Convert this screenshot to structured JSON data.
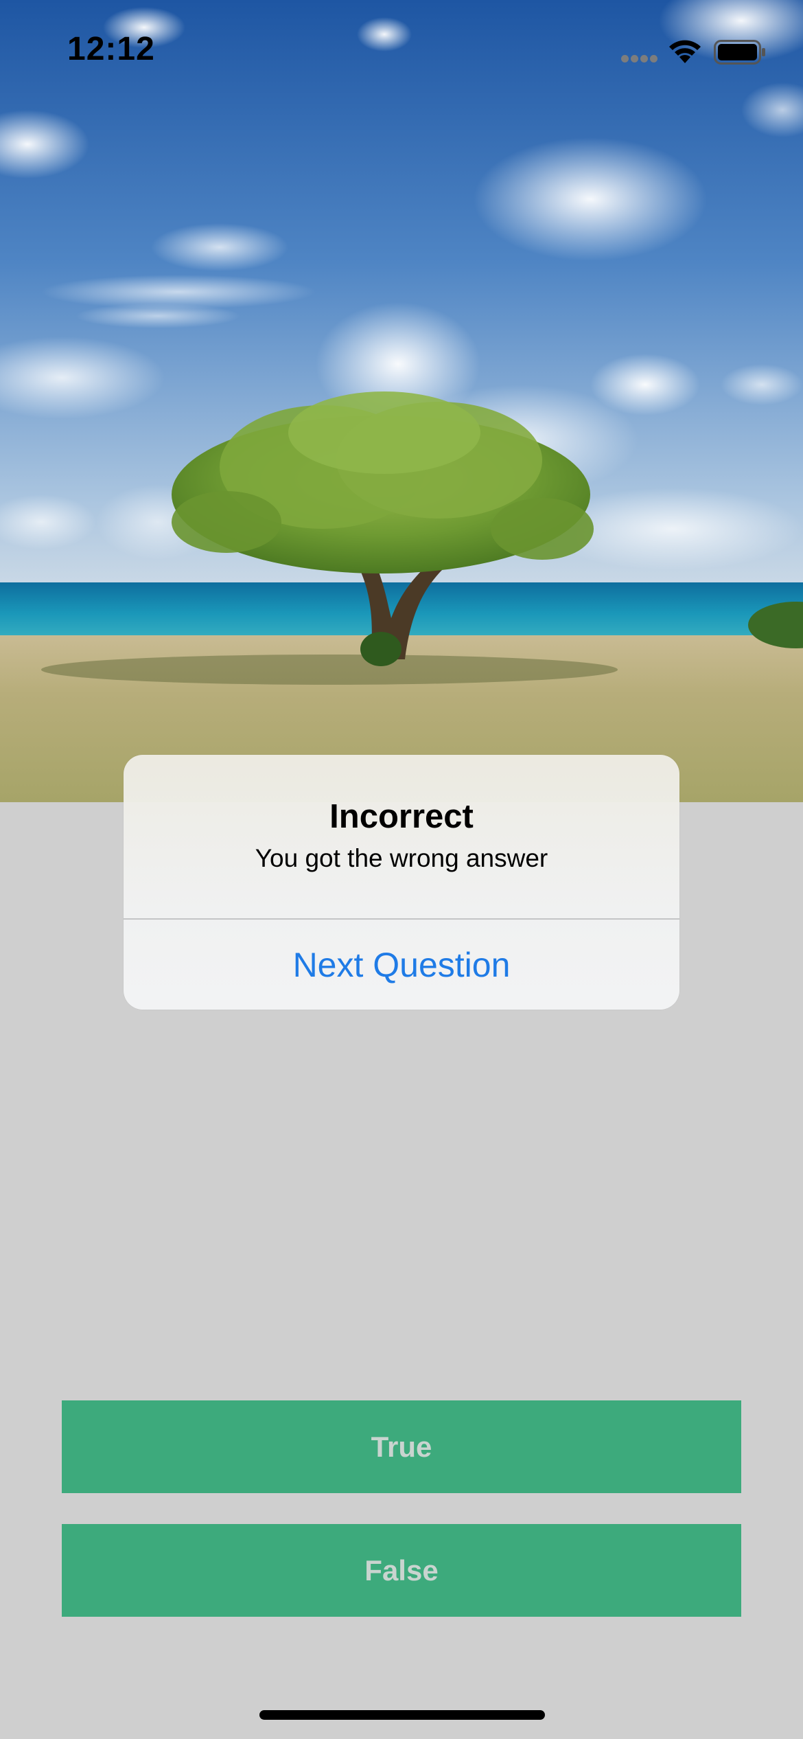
{
  "status_bar": {
    "time": "12:12",
    "icons": [
      "cellular-signal-icon",
      "wifi-icon",
      "battery-icon"
    ]
  },
  "hero": {
    "image": "tree-on-beach-photo"
  },
  "alert": {
    "title": "Incorrect",
    "message": "You got the wrong answer",
    "action_label": "Next Question"
  },
  "answers": {
    "true_label": "True",
    "false_label": "False"
  },
  "colors": {
    "answer_button": "#3daa7c",
    "answer_text": "#c9d4cf",
    "alert_action": "#1f7be6",
    "backdrop": "#cfcfcf"
  }
}
